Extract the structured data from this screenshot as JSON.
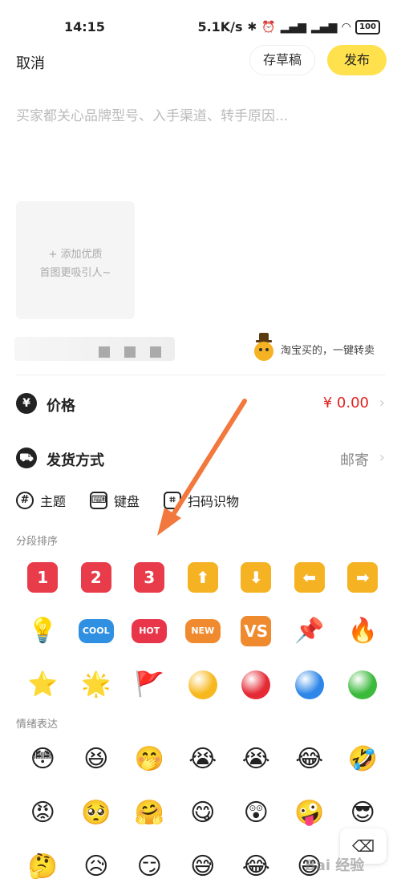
{
  "status_bar": {
    "time": "14:15",
    "speed": "5.1K/s",
    "battery": "100"
  },
  "topbar": {
    "cancel": "取消",
    "draft": "存草稿",
    "publish": "发布"
  },
  "description": {
    "placeholder": "买家都关心品牌型号、入手渠道、转手原因..."
  },
  "add_photo": {
    "line1": "+ 添加优质",
    "line2": "首图更吸引人~"
  },
  "taobao": {
    "label": "淘宝买的，一键转卖"
  },
  "price": {
    "icon": "yen-icon",
    "label": "价格",
    "value": "¥ 0.00",
    "value_color": "#e02020"
  },
  "shipping": {
    "icon": "truck-icon",
    "label": "发货方式",
    "value": "邮寄"
  },
  "toolbar": {
    "topic": "主题",
    "keyboard": "键盘",
    "scan": "扫码识物"
  },
  "emoji_sections": {
    "sort_title": "分段排序",
    "emotion_title": "情绪表达"
  },
  "sort_emojis": [
    {
      "type": "tile",
      "text": "1",
      "color": "#e83c4b"
    },
    {
      "type": "tile",
      "text": "2",
      "color": "#e83c4b"
    },
    {
      "type": "tile",
      "text": "3",
      "color": "#e83c4b"
    },
    {
      "type": "tile",
      "text": "⬆",
      "color": "#f5b324"
    },
    {
      "type": "tile",
      "text": "⬇",
      "color": "#f5b324"
    },
    {
      "type": "tile",
      "text": "⬅",
      "color": "#f5b324"
    },
    {
      "type": "tile",
      "text": "➡",
      "color": "#f5b324"
    },
    {
      "type": "glyph",
      "text": "💡"
    },
    {
      "type": "small",
      "text": "COOL",
      "color": "#2f8fe0"
    },
    {
      "type": "small",
      "text": "HOT",
      "color": "#e8354a"
    },
    {
      "type": "small",
      "text": "NEW",
      "color": "#f08a2e"
    },
    {
      "type": "tile",
      "text": "VS",
      "color": "#f08a2e"
    },
    {
      "type": "glyph",
      "text": "📌"
    },
    {
      "type": "glyph",
      "text": "🔥"
    },
    {
      "type": "glyph",
      "text": "⭐"
    },
    {
      "type": "glyph",
      "text": "🌟"
    },
    {
      "type": "glyph",
      "text": "🚩"
    },
    {
      "type": "circle",
      "color": "#f7b81e"
    },
    {
      "type": "circle",
      "color": "#e52a36"
    },
    {
      "type": "circle",
      "color": "#2d86e8"
    },
    {
      "type": "circle",
      "color": "#3cba3c"
    }
  ],
  "emotion_emojis": [
    "😳",
    "😆",
    "🤭",
    "😭",
    "😭",
    "😂",
    "🤣",
    "😡",
    "🥺",
    "🤗",
    "😋",
    "😲",
    "🤪",
    "😎",
    "🤔",
    "😥",
    "😏",
    "😅",
    "😂",
    "😄",
    ""
  ]
}
